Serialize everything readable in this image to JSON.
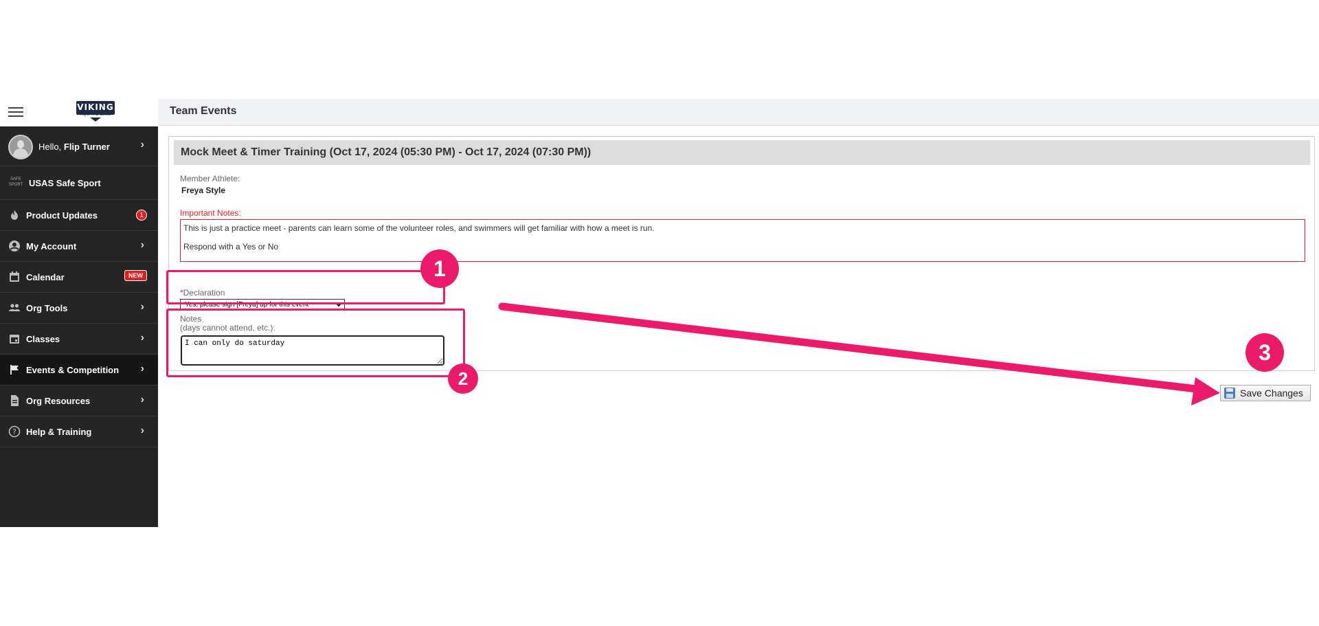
{
  "sidebar": {
    "user": {
      "greeting": "Hello,",
      "name": "Flip Turner"
    },
    "logo": {
      "word": "VIKING",
      "sub": "AQUATIC CLUB"
    },
    "items": [
      {
        "label": "USAS Safe Sport",
        "icon": "safe-sport-icon"
      },
      {
        "label": "Product Updates",
        "icon": "flame-icon",
        "badge": "1"
      },
      {
        "label": "My Account",
        "icon": "account-circle-icon"
      },
      {
        "label": "Calendar",
        "icon": "calendar-icon",
        "badge": "NEW"
      },
      {
        "label": "Org Tools",
        "icon": "people-icon"
      },
      {
        "label": "Classes",
        "icon": "calendar-event-icon"
      },
      {
        "label": "Events & Competition",
        "icon": "flag-icon"
      },
      {
        "label": "Org Resources",
        "icon": "document-icon"
      },
      {
        "label": "Help & Training",
        "icon": "help-circle-icon"
      }
    ],
    "safe_sport_mark": "SAFE SPORT"
  },
  "header": {
    "title": "Team Events"
  },
  "event": {
    "title": "Mock Meet & Timer Training (Oct 17, 2024 (05:30 PM) - Oct 17, 2024 (07:30 PM))",
    "member_label": "Member Athlete:",
    "member_name": "Freya Style",
    "notes_label": "Important Notes:",
    "notes_line1": "This is just a practice meet - parents can learn some of the volunteer roles, and swimmers will get familiar with how a meet is run.",
    "notes_line2": "Respond with a Yes or No",
    "declaration_required_mark": "*",
    "declaration_label": "Declaration",
    "declaration_value": "Yes, please sign [Freya] up for this event",
    "notes_field_label": "Notes",
    "notes_field_hint": "(days cannot attend, etc.):",
    "notes_field_value": "I can only do saturday"
  },
  "actions": {
    "save_label": "Save Changes"
  },
  "annotations": {
    "step1": "1",
    "step2": "2",
    "step3": "3"
  },
  "colors": {
    "annotation": "#ec1a6c",
    "sidebar_bg": "#252525",
    "notes_border": "#e0202a"
  }
}
